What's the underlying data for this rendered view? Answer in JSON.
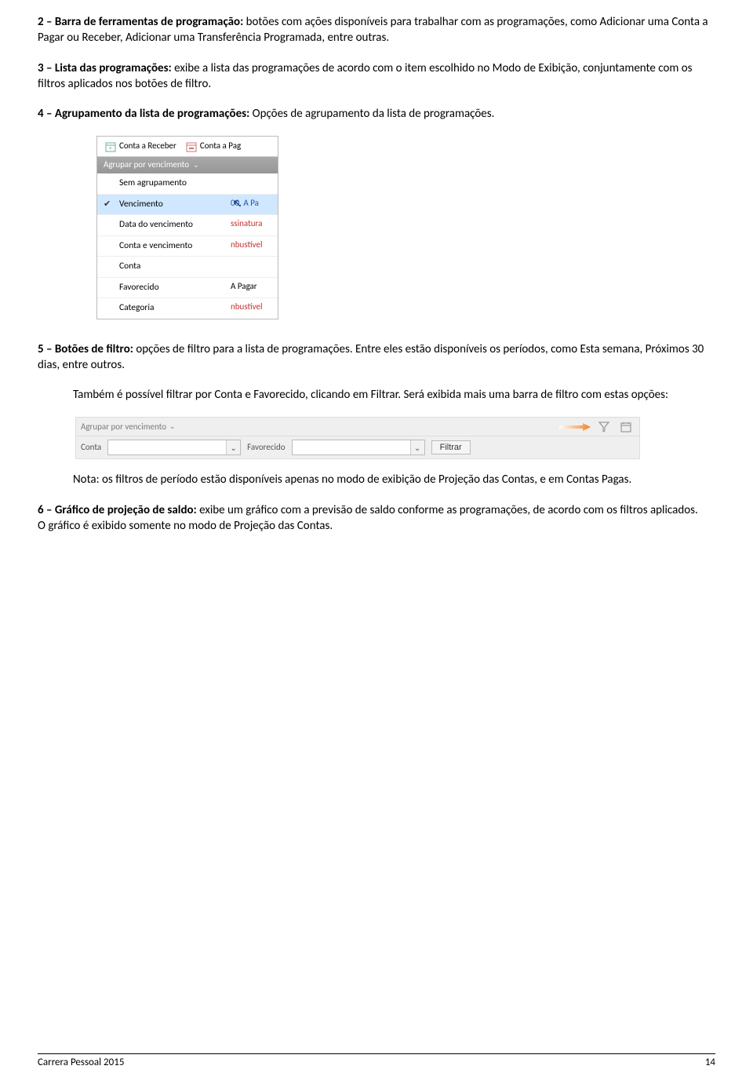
{
  "para2": {
    "bold": "2 – Barra de ferramentas de programação: ",
    "text": "botões com ações disponíveis para trabalhar com as programações, como Adicionar uma Conta a Pagar ou Receber, Adicionar uma Transferência Programada, entre outras."
  },
  "para3": {
    "bold": "3 – Lista das programações: ",
    "text": "exibe a lista das programações de acordo com o item escolhido no Modo de Exibição, conjuntamente com os filtros aplicados nos botões de filtro."
  },
  "para4": {
    "bold": "4 – Agrupamento da lista de programações: ",
    "text": "Opções de agrupamento da lista de programações."
  },
  "shot1": {
    "tabs": [
      "Conta a Receber",
      "Conta a Pag"
    ],
    "group_label": "Agrupar por vencimento",
    "items": [
      "Sem agrupamento",
      "Vencimento",
      "Data do vencimento",
      "Conta e vencimento",
      "Conta",
      "Favorecido",
      "Categoria"
    ],
    "behind": [
      "00,  A Pa",
      "ssinatura",
      "nbustível",
      "",
      "A Pagar",
      "nbustível"
    ]
  },
  "para5": {
    "bold": "5 – Botões de filtro: ",
    "text": "opções de filtro para a lista de programações. Entre eles estão disponíveis os períodos, como Esta semana, Próximos 30 dias, entre outros."
  },
  "para5a": "Também é possível filtrar por Conta e Favorecido, clicando em Filtrar. Será exibida mais uma barra de filtro com estas opções:",
  "shot2": {
    "group_label": "Agrupar por vencimento",
    "conta_label": "Conta",
    "favorecido_label": "Favorecido",
    "filtrar": "Filtrar"
  },
  "para5note": "Nota: os filtros de período estão disponíveis apenas no modo de exibição de Projeção das Contas, e em Contas Pagas.",
  "para6": {
    "bold": "6 – Gráfico de projeção de saldo: ",
    "text": "exibe um gráfico com a previsão de saldo conforme as programações, de acordo com os filtros aplicados."
  },
  "para6a": "O gráfico é exibido somente no modo de Projeção das Contas.",
  "footer": {
    "left": "Carrera Pessoal 2015",
    "right": "14"
  }
}
